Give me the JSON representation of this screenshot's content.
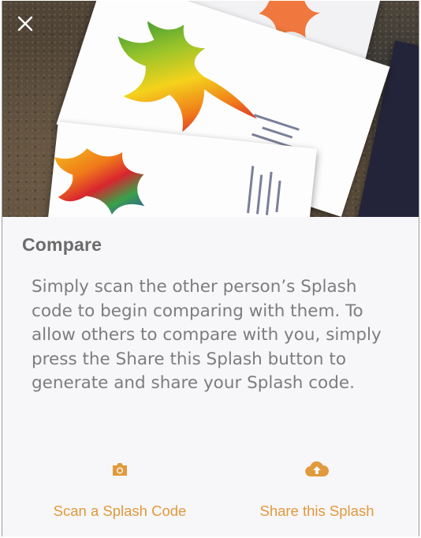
{
  "colors": {
    "accent": "#e09a3c",
    "title_text": "#6b6b6b",
    "body_text": "#7d7d7d",
    "background": "#f7f6f8"
  },
  "header": {
    "close_icon": "close-icon"
  },
  "content": {
    "title": "Compare",
    "description": "Simply scan the other person’s Splash code to begin comparing with them. To allow others to compare with you, simply press the Share this Splash button to generate and share your Splash code."
  },
  "actions": {
    "scan": {
      "label": "Scan a Splash Code",
      "icon": "camera-icon"
    },
    "share": {
      "label": "Share this Splash",
      "icon": "cloud-upload-icon"
    }
  }
}
